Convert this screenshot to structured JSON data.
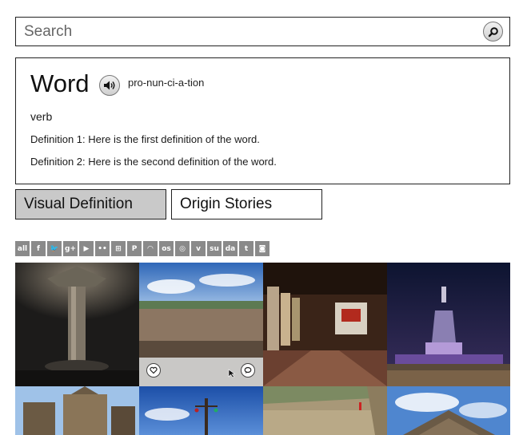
{
  "search": {
    "placeholder": "Search",
    "icon": "search-icon"
  },
  "definition": {
    "word": "Word",
    "audio_icon": "speaker-icon",
    "pronunciation": "pro-nun-ci-a-tion",
    "part_of_speech": "verb",
    "definitions": [
      "Definition 1: Here is the first definition of the word.",
      "Definition 2: Here is the second definition of the word."
    ]
  },
  "tabs": [
    {
      "label": "Visual Definition",
      "selected": true
    },
    {
      "label": "Origin Stories",
      "selected": false
    }
  ],
  "social_icons": [
    {
      "name": "all",
      "glyph": "all"
    },
    {
      "name": "facebook",
      "glyph": "f"
    },
    {
      "name": "twitter",
      "glyph": "🐦"
    },
    {
      "name": "google-plus",
      "glyph": "g+"
    },
    {
      "name": "youtube",
      "glyph": "▶"
    },
    {
      "name": "flickr",
      "glyph": "••"
    },
    {
      "name": "windows",
      "glyph": "⊞"
    },
    {
      "name": "pinterest",
      "glyph": "P"
    },
    {
      "name": "rss",
      "glyph": "◠"
    },
    {
      "name": "lastfm",
      "glyph": "os"
    },
    {
      "name": "dribbble",
      "glyph": "◎"
    },
    {
      "name": "vimeo",
      "glyph": "v"
    },
    {
      "name": "stumbleupon",
      "glyph": "su"
    },
    {
      "name": "deviantart",
      "glyph": "da"
    },
    {
      "name": "tumblr",
      "glyph": "t"
    },
    {
      "name": "instagram",
      "glyph": "◙"
    }
  ],
  "colors": {
    "selected_tab": "#c9c9c9",
    "social_icon": "#8a8a8a",
    "border": "#222222"
  },
  "photo_overlay": {
    "like_icon": "heart-icon",
    "comment_icon": "comment-icon"
  }
}
